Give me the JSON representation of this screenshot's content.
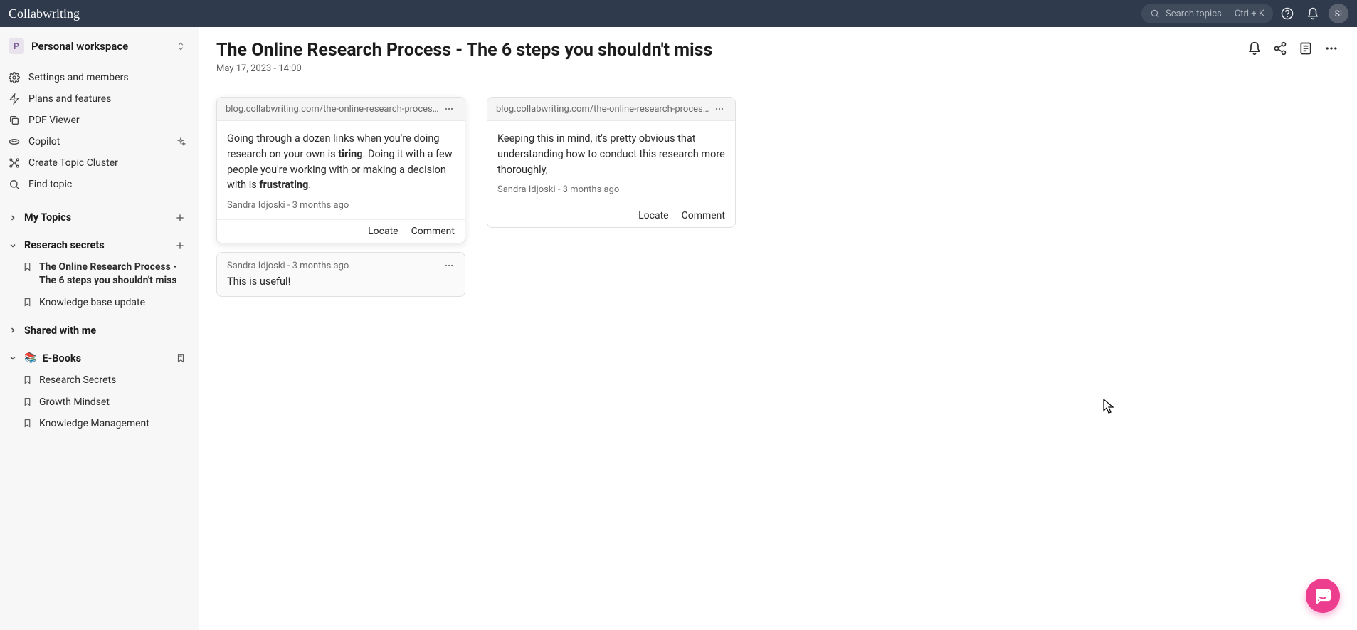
{
  "topbar": {
    "logo": "Collabwriting",
    "search_placeholder": "Search topics",
    "search_shortcut": "Ctrl + K",
    "avatar": "SI"
  },
  "sidebar": {
    "workspace_initial": "P",
    "workspace_name": "Personal workspace",
    "items": {
      "settings": "Settings and members",
      "plans": "Plans and features",
      "pdf": "PDF Viewer",
      "copilot": "Copilot",
      "cluster": "Create Topic Cluster",
      "find": "Find topic"
    },
    "sections": {
      "my_topics": "My Topics",
      "research_secrets": "Reserach secrets",
      "shared": "Shared with me",
      "ebooks": "E-Books"
    },
    "research_secrets_children": {
      "a": "The Online Research Process - The 6 steps you shouldn't miss",
      "b": "Knowledge base update"
    },
    "ebooks_children": {
      "a": "Research Secrets",
      "b": "Growth Mindset",
      "c": "Knowledge Management"
    }
  },
  "page": {
    "title": "The Online Research Process - The 6 steps you shouldn't miss",
    "date": "May 17, 2023 - 14:00"
  },
  "cards": {
    "c1": {
      "source": "blog.collabwriting.com/the-online-research-process-th...",
      "body_pre": "Going through a dozen links when you're doing research on your own is ",
      "body_b1": "tiring",
      "body_mid": ". Doing it with a few people you're working with or making a decision with is ",
      "body_b2": "frustrating",
      "body_post": ".",
      "author": "Sandra Idjoski - 3 months ago",
      "locate": "Locate",
      "comment": "Comment"
    },
    "c2": {
      "source": "blog.collabwriting.com/the-online-research-process-th...",
      "body": "Keeping this in mind, it's pretty obvious that understanding how to conduct this research more thoroughly,",
      "author": "Sandra Idjoski - 3 months ago",
      "locate": "Locate",
      "comment": "Comment"
    },
    "comment1": {
      "meta": "Sandra Idjoski  -  3 months ago",
      "text": "This is useful!"
    }
  }
}
